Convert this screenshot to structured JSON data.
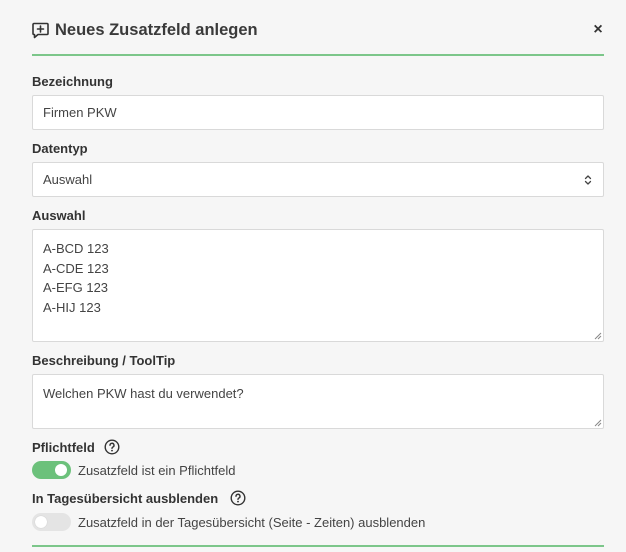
{
  "dialog": {
    "title": "Neues Zusatzfeld anlegen",
    "close_label": "×",
    "accent_color": "#7cc68a"
  },
  "fields": {
    "bezeichnung": {
      "label": "Bezeichnung",
      "value": "Firmen PKW"
    },
    "datentyp": {
      "label": "Datentyp",
      "value": "Auswahl"
    },
    "auswahl": {
      "label": "Auswahl",
      "value": "A-BCD 123\nA-CDE 123\nA-EFG 123\nA-HIJ 123"
    },
    "beschreibung": {
      "label": "Beschreibung / ToolTip",
      "value": "Welchen PKW hast du verwendet?"
    }
  },
  "toggles": {
    "pflichtfeld": {
      "label": "Pflichtfeld",
      "text": "Zusatzfeld ist ein Pflichtfeld",
      "checked": true
    },
    "tagesuebersicht": {
      "label": "In Tagesübersicht ausblenden",
      "text": "Zusatzfeld in der Tagesübersicht (Seite - Zeiten) ausblenden",
      "checked": false
    }
  },
  "icons": {
    "title_icon": "comment-plus-icon",
    "close": "close-icon",
    "select_chevron": "chevron-up-down-icon",
    "help": "help-circle-icon"
  }
}
